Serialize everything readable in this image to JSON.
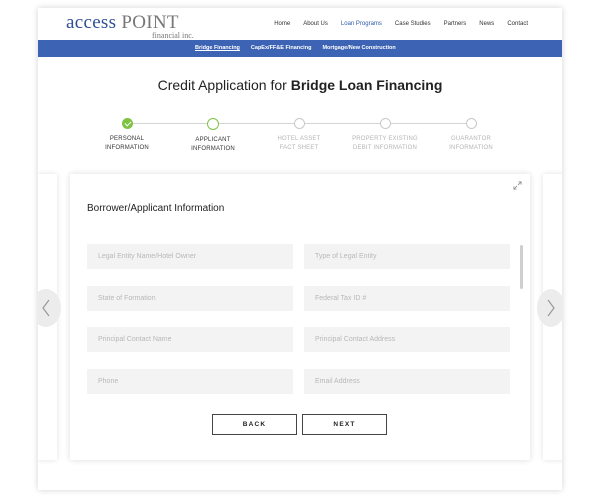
{
  "brand": {
    "name_part1": "access",
    "name_part2": "POINT",
    "subtitle": "financial inc."
  },
  "nav": {
    "items": [
      {
        "label": "Home",
        "active": false
      },
      {
        "label": "About Us",
        "active": false
      },
      {
        "label": "Loan Programs",
        "active": true
      },
      {
        "label": "Case Studies",
        "active": false
      },
      {
        "label": "Partners",
        "active": false
      },
      {
        "label": "News",
        "active": false
      },
      {
        "label": "Contact",
        "active": false
      }
    ]
  },
  "subnav": {
    "items": [
      {
        "label": "Bridge Financing",
        "active": true
      },
      {
        "label": "CapEx/FF&E Financing",
        "active": false
      },
      {
        "label": "Mortgage/New Construction",
        "active": false
      }
    ]
  },
  "page": {
    "title_prefix": "Credit Application for ",
    "title_bold": "Bridge Loan Financing"
  },
  "steps": [
    {
      "line1": "PERSONAL",
      "line2": "INFORMATION",
      "state": "done"
    },
    {
      "line1": "APPLICANT",
      "line2": "INFORMATION",
      "state": "current"
    },
    {
      "line1": "HOTEL ASSET",
      "line2": "FACT SHEET",
      "state": "upcoming"
    },
    {
      "line1": "PROPERTY EXISTING",
      "line2": "DEBIT INFORMATION",
      "state": "upcoming"
    },
    {
      "line1": "GUARANTOR",
      "line2": "INFORMATION",
      "state": "upcoming"
    }
  ],
  "form": {
    "heading": "Borrower/Applicant Information",
    "fields": {
      "legal_entity_name": {
        "placeholder": "Legal Entity Name/Hotel Owner",
        "value": ""
      },
      "legal_entity_type": {
        "placeholder": "Type of Legal Entity",
        "value": ""
      },
      "state_of_formation": {
        "placeholder": "State of Formation",
        "value": ""
      },
      "federal_tax_id": {
        "placeholder": "Federal Tax ID #",
        "value": ""
      },
      "principal_contact_name": {
        "placeholder": "Principal Contact Name",
        "value": ""
      },
      "principal_contact_address": {
        "placeholder": "Principal Contact Address",
        "value": ""
      },
      "phone": {
        "placeholder": "Phone",
        "value": ""
      },
      "email": {
        "placeholder": "Email Address",
        "value": ""
      }
    },
    "back_label": "BACK",
    "next_label": "NEXT"
  },
  "colors": {
    "brand_blue": "#3d63b4",
    "step_green": "#7ec242",
    "link_blue": "#2e5aa8"
  },
  "icons": {
    "expand": "expand-icon",
    "prev": "chevron-left-icon",
    "next": "chevron-right-icon",
    "check": "check-icon"
  }
}
